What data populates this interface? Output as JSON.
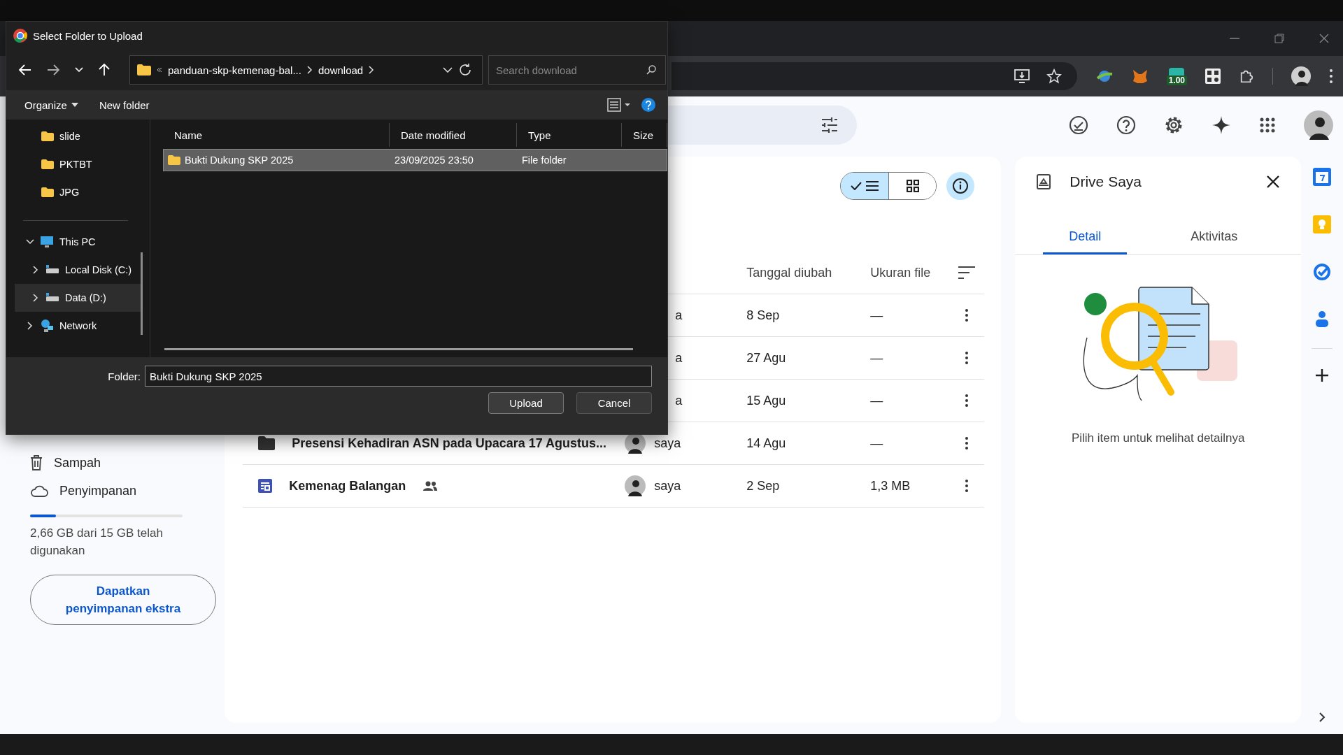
{
  "dialog": {
    "title": "Select Folder to Upload",
    "breadcrumb": [
      "panduan-skp-kemenag-bal...",
      "download"
    ],
    "search": {
      "placeholder": "Search download"
    },
    "toolbar": [
      "Organize",
      "New folder"
    ],
    "tree": [
      {
        "label": "slide",
        "kind": "folder",
        "selected": false
      },
      {
        "label": "PKTBT",
        "kind": "folder",
        "selected": false
      },
      {
        "label": "JPG",
        "kind": "folder",
        "selected": false
      },
      {
        "label": "This PC",
        "kind": "pc",
        "expanded": true,
        "selected": false,
        "children": [
          {
            "label": "Local Disk (C:)",
            "kind": "disk",
            "expanded": false,
            "selected": false
          },
          {
            "label": "Data (D:)",
            "kind": "disk",
            "expanded": false,
            "selected": true
          }
        ]
      },
      {
        "label": "Network",
        "kind": "network",
        "expanded": false,
        "selected": false
      }
    ],
    "columns": [
      "Name",
      "Date modified",
      "Type",
      "Size"
    ],
    "files": [
      {
        "name": "Bukti Dukung SKP 2025",
        "date": "23/09/2025 23:50",
        "type": "File folder",
        "selected": true
      }
    ],
    "folder_label": "Folder:",
    "folder_value": "Bukti Dukung SKP 2025",
    "buttons": [
      "Upload",
      "Cancel"
    ]
  },
  "browser": {
    "extension_badge": "1.00"
  },
  "drive": {
    "sidebar": [
      {
        "label": "Sampah",
        "kind": "trash"
      },
      {
        "label": "Penyimpanan",
        "kind": "cloud"
      }
    ],
    "storage": {
      "level": 0.17,
      "text": "2,66 GB dari 15 GB telah digunakan"
    },
    "storage_button": "Dapatkan penyimpanan ekstra",
    "view_toggle": [
      {
        "kind": "list",
        "selected": true
      },
      {
        "kind": "grid",
        "selected": false
      }
    ],
    "columns": [
      "Tanggal diubah",
      "Ukuran file"
    ],
    "rows": [
      {
        "name": "",
        "owner": "a",
        "avatar": false,
        "date": "8 Sep",
        "size": "—"
      },
      {
        "name": "",
        "owner": "a",
        "avatar": false,
        "date": "27 Agu",
        "size": "—"
      },
      {
        "name": "",
        "owner": "a",
        "avatar": false,
        "date": "15 Agu",
        "size": "—"
      },
      {
        "name": "Presensi Kehadiran ASN pada Upacara 17 Agustus...",
        "kind": "folder",
        "owner": "saya",
        "avatar": true,
        "date": "14 Agu",
        "size": "—"
      },
      {
        "name": "Kemenag Balangan",
        "kind": "form",
        "shared": true,
        "owner": "saya",
        "avatar": true,
        "date": "2 Sep",
        "size": "1,3 MB"
      }
    ],
    "details": {
      "title": "Drive Saya",
      "tabs": [
        {
          "label": "Detail",
          "selected": true
        },
        {
          "label": "Aktivitas",
          "selected": false
        }
      ],
      "empty_text": "Pilih item untuk melihat detailnya"
    }
  }
}
